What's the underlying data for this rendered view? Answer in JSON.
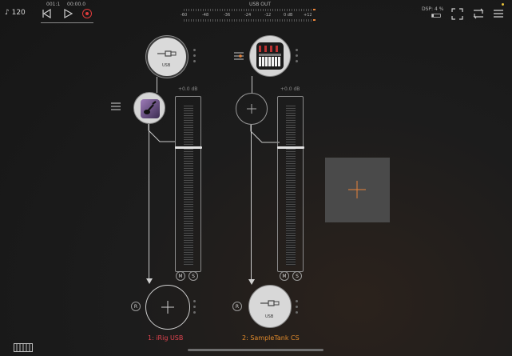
{
  "transport": {
    "tempo": "♪ 120",
    "bar_position": "001:1",
    "time": "00:00.0"
  },
  "meter": {
    "title": "USB OUT",
    "scale_labels": [
      "-60",
      "-48",
      "-36",
      "-24",
      "-12",
      "0 dB",
      "+12"
    ]
  },
  "top_right": {
    "dsp_label": "DSP: 4 %"
  },
  "channels": [
    {
      "name": "1: iRig USB",
      "input_label": "USB",
      "gain_label": "+0.0 dB",
      "mute_label": "M",
      "solo_label": "S",
      "record_label": "R",
      "name_color": "#e0434f"
    },
    {
      "name": "2: SampleTank CS",
      "output_label": "USB",
      "gain_label": "+0.0 dB",
      "mute_label": "M",
      "solo_label": "S",
      "record_label": "R",
      "name_color": "#e08a2c"
    }
  ],
  "icons": [
    "note-icon",
    "rewind-icon",
    "play-icon",
    "record-icon",
    "fullscreen-icon",
    "routing-icon",
    "menu-icon",
    "keyboard-icon",
    "plus-icon",
    "usb-plug-icon",
    "hamburger-icon",
    "eq-slider-icon"
  ],
  "colors": {
    "record": "#e03c3c",
    "add_accent": "#e8833a",
    "background": "#1c1c1c"
  }
}
